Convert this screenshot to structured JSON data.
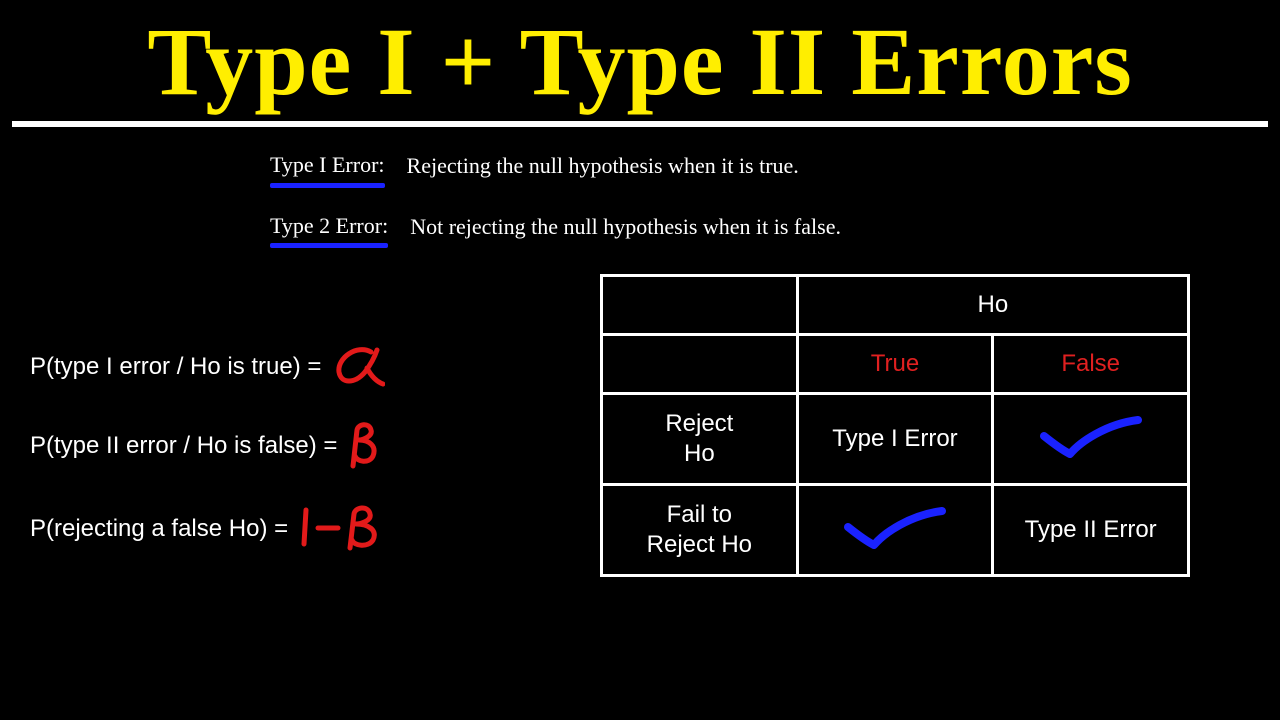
{
  "title": "Type I + Type II Errors",
  "definitions": {
    "type1_label": "Type I Error:",
    "type1_text": "Rejecting the null hypothesis when it is true.",
    "type2_label": "Type 2 Error:",
    "type2_text": "Not rejecting the null hypothesis when it is false."
  },
  "probabilities": {
    "p1_text": "P(type I error / Ho is true)  =",
    "p1_symbol": "alpha",
    "p2_text": "P(type II error / Ho is false)  =",
    "p2_symbol": "beta",
    "p3_text": "P(rejecting a false Ho) =",
    "p3_symbol": "one-minus-beta"
  },
  "table": {
    "top_header": "Ho",
    "col_true": "True",
    "col_false": "False",
    "row_reject_line1": "Reject",
    "row_reject_line2": "Ho",
    "row_fail_line1": "Fail to",
    "row_fail_line2": "Reject Ho",
    "cell_t1": "Type I Error",
    "cell_t2": "Type II Error",
    "check_icon": "check-icon"
  },
  "colors": {
    "title_yellow": "#ffee00",
    "underline_blue": "#1a22ff",
    "symbol_red": "#e21a1a",
    "table_red": "#e02020",
    "check_blue": "#1a22ff"
  }
}
